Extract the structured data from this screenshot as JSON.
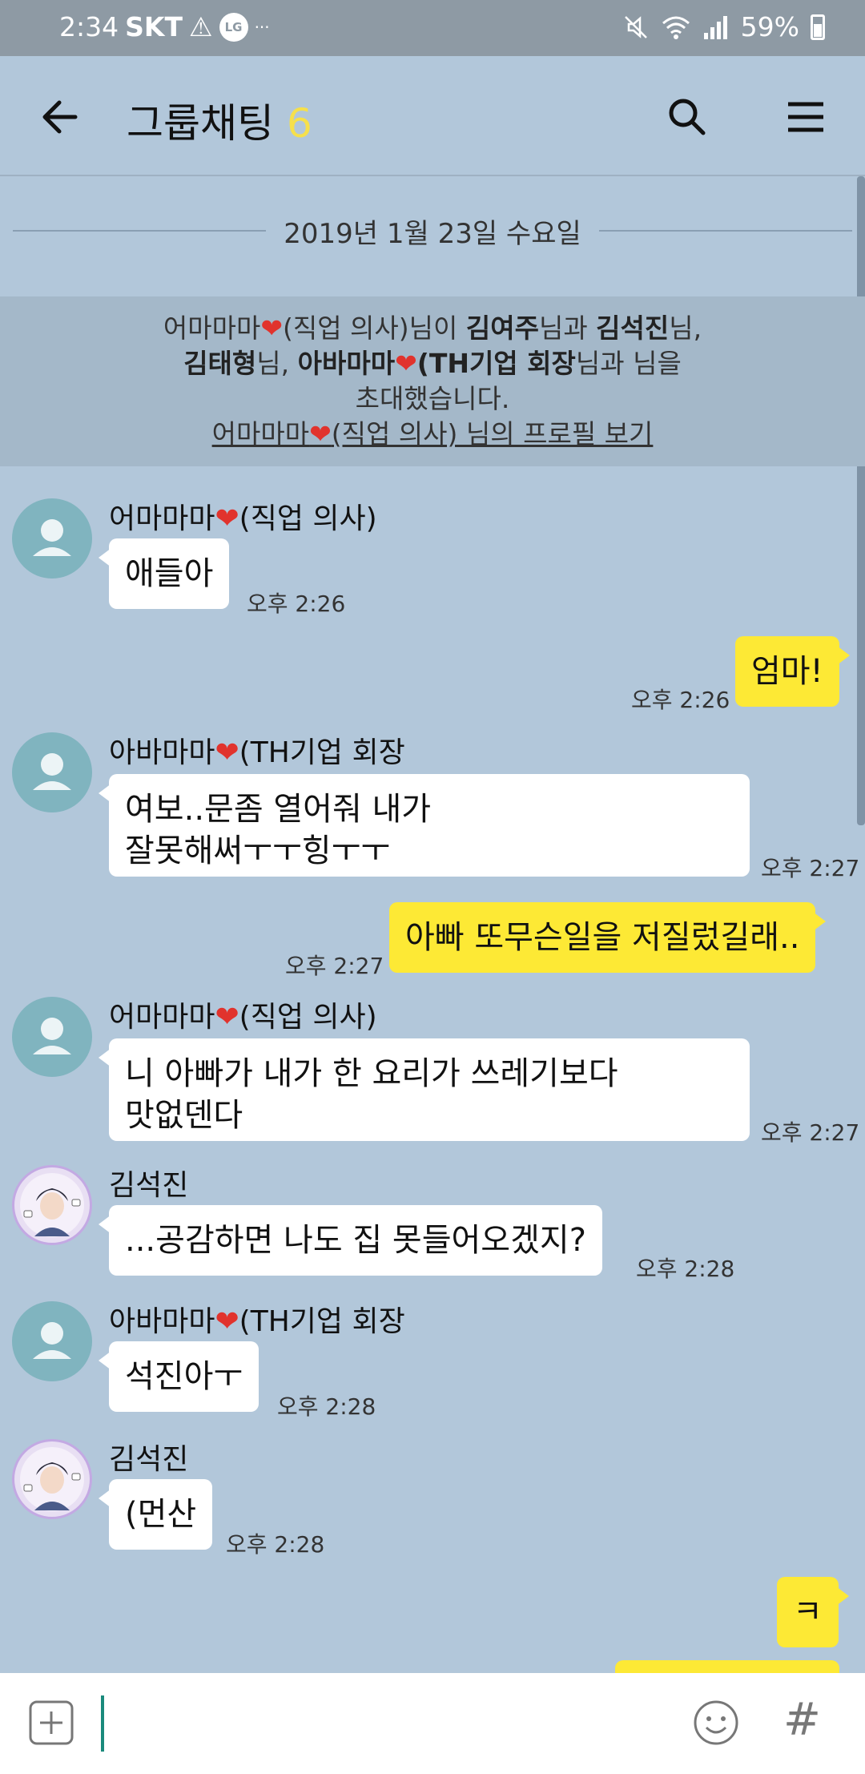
{
  "status_bar": {
    "time": "2:34",
    "carrier": "SKT",
    "alert_glyph": "⚠",
    "lg_badge": "LG",
    "more": "···",
    "battery": "59%"
  },
  "header": {
    "title": "그룹채팅",
    "member_count": "6"
  },
  "date_divider": "2019년 1월 23일 수요일",
  "system_notice": {
    "line1_pre": "어마마마",
    "line1_heart": "❤",
    "line1_mid": "(직업 의사)님이 ",
    "name_a": "김여주",
    "line1_and": "님과 ",
    "name_b": "김석진",
    "line1_end": "님,",
    "name_c": "김태형",
    "line2_sep": "님, ",
    "name_d_pre": "아바마마",
    "name_d_heart": "❤",
    "name_d_post": "(TH기업 회장",
    "line2_end": "님과 님을",
    "line3": "초대했습니다.",
    "link_pre": "어마마마",
    "link_heart": "❤",
    "link_post": "(직업 의사) 님의 프로필 보기"
  },
  "messages": [
    {
      "sender_pre": "어마마마",
      "sender_heart": "❤",
      "sender_post": "(직업 의사)",
      "text": "애들아",
      "time": "오후 2:26"
    },
    {
      "text": "엄마!",
      "time": "오후 2:26"
    },
    {
      "sender_pre": "아바마마",
      "sender_heart": "❤",
      "sender_post": "(TH기업 회장",
      "line1": "여보..문좀 열어줘 내가",
      "line2": "잘못해써ㅜㅜ힝ㅜㅜ",
      "time": "오후 2:27"
    },
    {
      "text": "아빠 또무슨일을 저질렀길래..",
      "time": "오후 2:27"
    },
    {
      "sender_pre": "어마마마",
      "sender_heart": "❤",
      "sender_post": "(직업 의사)",
      "line1": "니 아빠가 내가 한 요리가 쓰레기보다",
      "line2": "맛없덴다",
      "time": "오후 2:27"
    },
    {
      "sender": "김석진",
      "text": "...공감하면 나도 집 못들어오겠지?",
      "time": "오후 2:28"
    },
    {
      "sender_pre": "아바마마",
      "sender_heart": "❤",
      "sender_post": "(TH기업 회장",
      "text": "석진아ㅜ",
      "time": "오후 2:28"
    },
    {
      "sender": "김석진",
      "text": "(먼산",
      "time": "오후 2:28"
    },
    {
      "text": "ㅋ"
    }
  ],
  "input": {
    "placeholder": "",
    "hash_glyph": "#"
  },
  "colors": {
    "chat_background": "#b2c7da",
    "my_bubble": "#fde935",
    "their_bubble": "#ffffff",
    "member_count": "#f6e04b",
    "heart": "#e1332d"
  },
  "icons": [
    "back-arrow-icon",
    "search-icon",
    "menu-icon",
    "plus-icon",
    "emoji-icon",
    "hash-icon",
    "default-avatar-icon",
    "profile-photo-icon"
  ]
}
